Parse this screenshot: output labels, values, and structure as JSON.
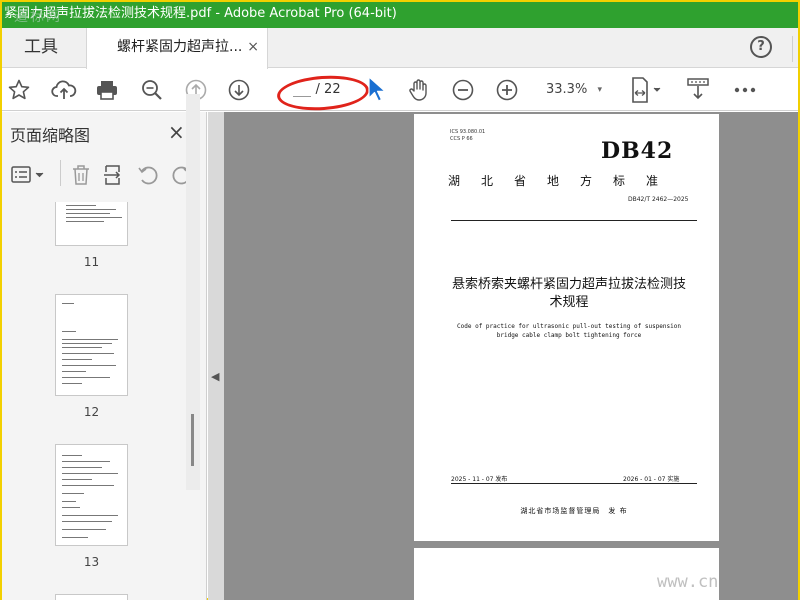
{
  "window": {
    "title": "紧固力超声拉拔法检测技术规程.pdf - Adobe Acrobat Pro (64-bit)",
    "watermark_top": "道标网",
    "watermark_bottom": "www.cn"
  },
  "tabs": {
    "tools_label": "工具",
    "doc_label": "螺杆紧固力超声拉...",
    "doc_close": "×",
    "help": "?"
  },
  "toolbar": {
    "page_separator": "/ 22",
    "zoom_value": "33.3%",
    "zoom_caret": "▾",
    "icons": [
      "star-icon",
      "upload-cloud-icon",
      "print-icon",
      "zoom-search-icon",
      "prev-page-icon",
      "next-page-icon",
      "hand-icon",
      "zoom-out-icon",
      "zoom-in-icon",
      "page-fit-icon",
      "scroll-mode-icon",
      "more-icon"
    ]
  },
  "sidebar": {
    "title": "页面缩略图",
    "close": "×",
    "thumbnails": [
      {
        "label": "11"
      },
      {
        "label": "12"
      },
      {
        "label": "13"
      }
    ]
  },
  "document": {
    "ics_line1": "ICS  93.080.01",
    "ics_line2": "CCS  P 66",
    "standard_code": "DB42",
    "province": "湖北省地方标准",
    "standard_number": "DB42/T 2462—2025",
    "title_cn_line1": "悬索桥索夹螺杆紧固力超声拉拔法检测技",
    "title_cn_line2": "术规程",
    "title_en_line1": "Code of practice for ultrasonic pull-out testing of suspension",
    "title_en_line2": "bridge cable clamp bolt tightening force",
    "publish_date": "2025 - 11 - 07 发布",
    "implement_date": "2026 - 01 - 07 实施",
    "issuer": "湖北省市场监督管理局　发 布"
  },
  "colors": {
    "title_bar": "#2fa12f",
    "annotation_red": "#e0231b",
    "cursor_blue": "#1a6fd1",
    "doc_background": "#8e8e8e"
  }
}
